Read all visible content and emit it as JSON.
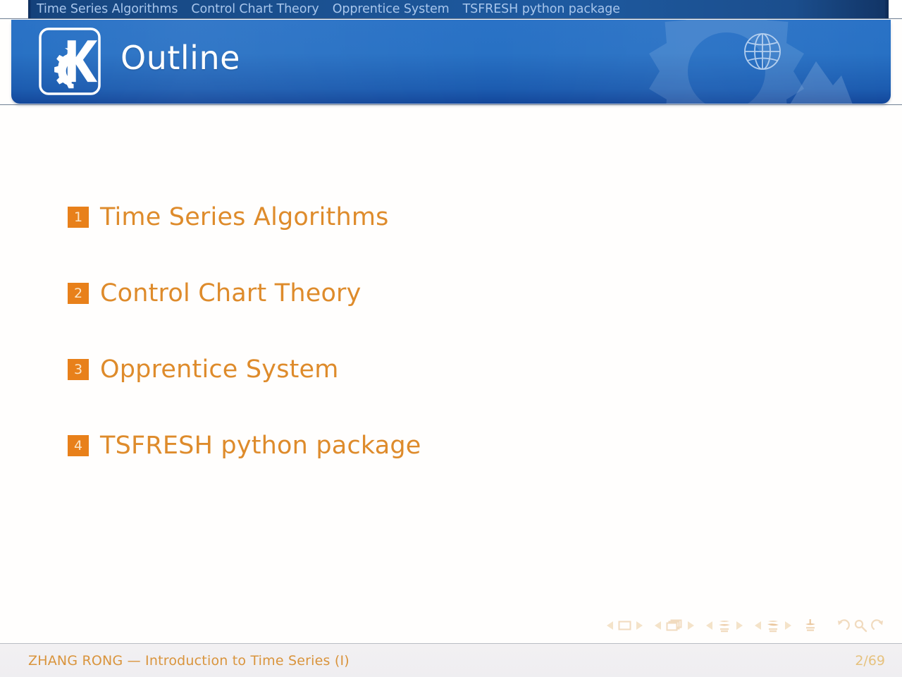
{
  "navbar": {
    "sections": [
      {
        "label": "Time Series Algorithms"
      },
      {
        "label": "Control Chart Theory"
      },
      {
        "label": "Opprentice System"
      },
      {
        "label": "TSFRESH python package"
      }
    ]
  },
  "header": {
    "title": "Outline",
    "logo_icon": "kde-gear-logo-icon",
    "globe_icon": "globe-icon",
    "watermark_icon": "gear-watermark-icon",
    "mountain_icon": "mountain-decoration-icon",
    "background_color": "#2a72c6",
    "background_color_dark": "#13479a"
  },
  "outline": {
    "items": [
      {
        "number": "1",
        "label": "Time Series Algorithms"
      },
      {
        "number": "2",
        "label": "Control Chart Theory"
      },
      {
        "number": "3",
        "label": "Opprentice System"
      },
      {
        "number": "4",
        "label": "TSFRESH python package"
      }
    ],
    "badge_color": "#E8801A",
    "label_color": "#DE8B2B"
  },
  "nav_symbols": {
    "groups": [
      {
        "name": "slide-navigation",
        "prev_icon": "triangle-left-icon",
        "center_icon": "single-frame-icon",
        "next_icon": "triangle-right-icon"
      },
      {
        "name": "frame-navigation",
        "prev_icon": "triangle-left-icon",
        "center_icon": "stacked-frames-icon",
        "next_icon": "triangle-right-icon"
      },
      {
        "name": "subsection-navigation",
        "prev_icon": "triangle-left-icon",
        "center_icon": "subsection-icon",
        "next_icon": "triangle-right-icon"
      },
      {
        "name": "section-navigation",
        "prev_icon": "triangle-left-icon",
        "center_icon": "section-icon",
        "next_icon": "triangle-right-icon"
      }
    ],
    "doc_icon": "document-icon",
    "back_icon": "undo-back-icon",
    "search_icon": "search-icon",
    "forward_icon": "redo-forward-icon"
  },
  "footer": {
    "author_and_title": "ZHANG RONG — Introduction to Time Series (I)",
    "page": "2/69",
    "text_color": "#D9943C"
  }
}
